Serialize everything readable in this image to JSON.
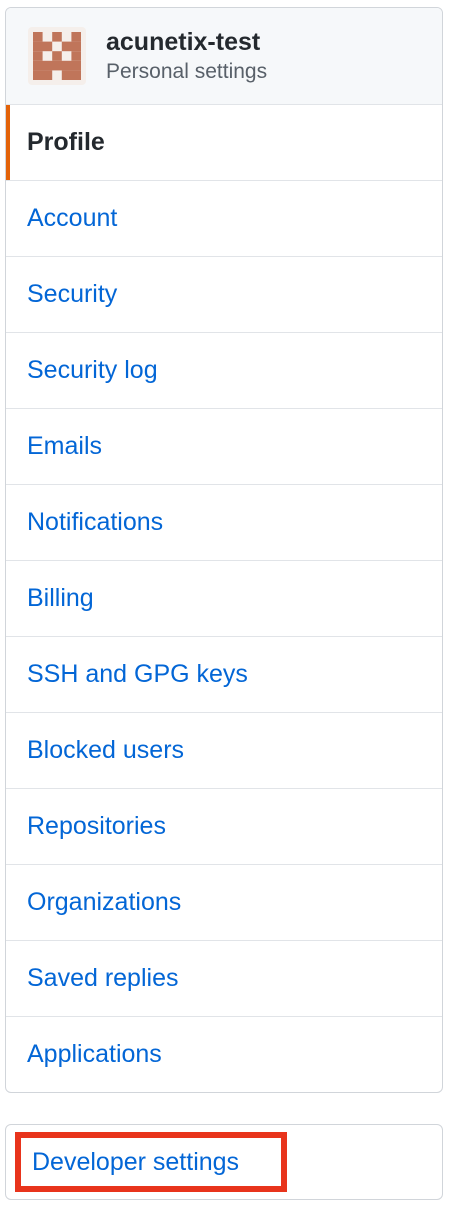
{
  "header": {
    "username": "acunetix-test",
    "subtitle": "Personal settings",
    "avatar_color": "#c0755a"
  },
  "menu": {
    "items": [
      {
        "label": "Profile",
        "selected": true
      },
      {
        "label": "Account"
      },
      {
        "label": "Security"
      },
      {
        "label": "Security log"
      },
      {
        "label": "Emails"
      },
      {
        "label": "Notifications"
      },
      {
        "label": "Billing"
      },
      {
        "label": "SSH and GPG keys"
      },
      {
        "label": "Blocked users"
      },
      {
        "label": "Repositories"
      },
      {
        "label": "Organizations"
      },
      {
        "label": "Saved replies"
      },
      {
        "label": "Applications"
      }
    ]
  },
  "developer": {
    "label": "Developer settings",
    "highlight_color": "#e8341c"
  },
  "colors": {
    "link": "#0366d6",
    "selected_accent": "#e36209"
  }
}
